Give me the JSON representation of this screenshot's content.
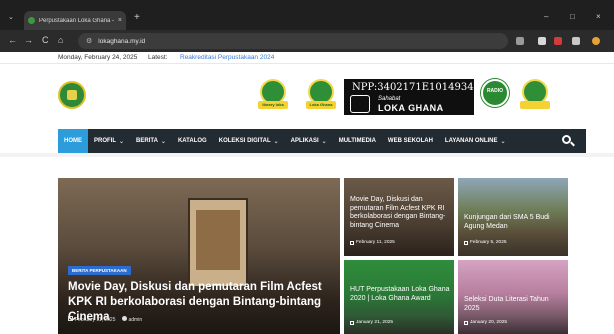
{
  "browser": {
    "tab_title": "Perpustakaan Loka Ghana – Sl...",
    "tab_close": "×",
    "new_tab": "+",
    "tab_list": "⌄",
    "url": "lokaghana.my.id",
    "back": "←",
    "forward": "→",
    "reload": "C",
    "home": "⌂",
    "tune": "⚙",
    "minimize": "–",
    "maximize": "□",
    "close": "×"
  },
  "topbar": {
    "date": "Monday, February 24, 2025",
    "latest_label": "Latest:",
    "latest_link": "Reakreditasi Perpustakaan 2024"
  },
  "header": {
    "badge1_label": "library loka",
    "badge2_label": "Loka Ghana",
    "npp_number": "NPP:3402171E1014934",
    "npp_tagline": "Sahabat",
    "npp_name": "LOKA GHANA",
    "radio_label": "RADIO"
  },
  "nav": {
    "items": [
      {
        "label": "HOME",
        "active": true,
        "dropdown": false
      },
      {
        "label": "PROFIL",
        "active": false,
        "dropdown": true
      },
      {
        "label": "BERITA",
        "active": false,
        "dropdown": true
      },
      {
        "label": "KATALOG",
        "active": false,
        "dropdown": false
      },
      {
        "label": "KOLEKSI DIGITAL",
        "active": false,
        "dropdown": true
      },
      {
        "label": "APLIKASI",
        "active": false,
        "dropdown": true
      },
      {
        "label": "MULTIMEDIA",
        "active": false,
        "dropdown": false
      },
      {
        "label": "WEB SEKOLAH",
        "active": false,
        "dropdown": false
      },
      {
        "label": "LAYANAN ONLINE",
        "active": false,
        "dropdown": true
      }
    ],
    "chevron": "⌄"
  },
  "featured": {
    "category": "BERITA PERPUSTAKAAN",
    "title": "Movie Day, Diskusi dan pemutaran Film Acfest KPK RI berkolaborasi dengan Bintang-bintang Cinema",
    "date": "February 11, 2025",
    "author": "admin"
  },
  "cards": [
    {
      "title": "Movie Day, Diskusi dan pemutaran Film Acfest KPK RI berkolaborasi dengan Bintang-bintang Cinema",
      "date": "February 11, 2025"
    },
    {
      "title": "Kunjungan dari SMA 5 Budi Agung Medan",
      "date": "February 5, 2025"
    },
    {
      "title": "HUT Perpustakaan Loka Ghana 2020 | Loka Ghana Award",
      "date": "January 21, 2025"
    },
    {
      "title": "Seleksi Duta Literasi Tahun 2025",
      "date": "January 20, 2025"
    }
  ],
  "colors": {
    "nav_bg": "#222a32",
    "nav_active": "#2d9cdb",
    "brand_green": "#2e8a36",
    "category_blue": "#2d6ccf"
  }
}
